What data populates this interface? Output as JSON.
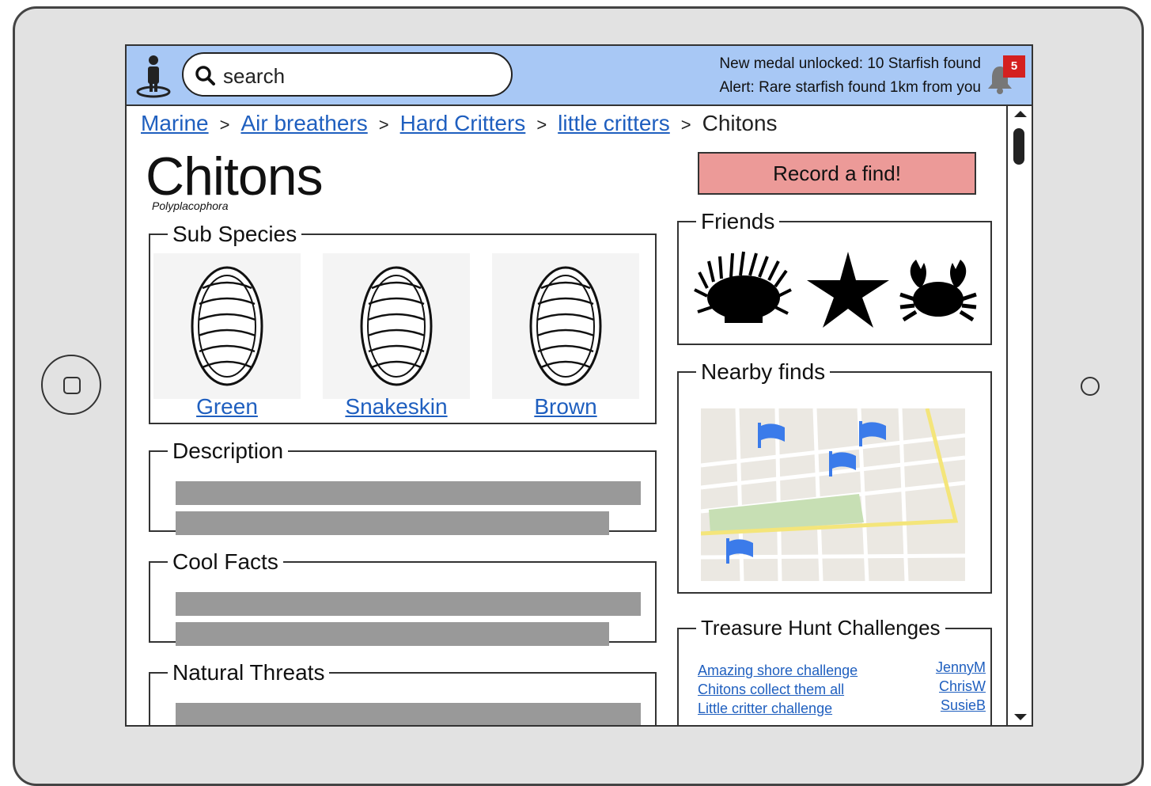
{
  "header": {
    "search_placeholder": "search",
    "alerts": [
      "New medal unlocked: 10 Starfish found",
      "Alert: Rare starfish found 1km from you"
    ],
    "notification_count": "5"
  },
  "breadcrumb": {
    "links": [
      "Marine",
      "Air breathers",
      "Hard Critters",
      "little critters"
    ],
    "current": "Chitons",
    "separator": ">"
  },
  "page": {
    "title": "Chitons",
    "scientific_name": "Polyplacophora",
    "record_button": "Record a find!"
  },
  "sub_species": {
    "legend": "Sub Species",
    "items": [
      "Green",
      "Snakeskin",
      "Brown"
    ]
  },
  "sections": {
    "description": "Description",
    "cool_facts": "Cool Facts",
    "natural_threats": "Natural Threats"
  },
  "friends": {
    "legend": "Friends",
    "icons": [
      "sea-anemone-icon",
      "starfish-icon",
      "crab-icon"
    ]
  },
  "nearby": {
    "legend": "Nearby finds",
    "markers": [
      "flag-icon",
      "flag-icon",
      "flag-icon",
      "flag-icon"
    ]
  },
  "challenges": {
    "legend": "Treasure Hunt Challenges",
    "items": [
      "Amazing shore challenge",
      "Chitons collect them all",
      "Little critter challenge"
    ],
    "users": [
      "JennyM",
      "ChrisW",
      "SusieB"
    ]
  },
  "colors": {
    "header_bg": "#a8c8f5",
    "record_button_bg": "#ec9a98",
    "link": "#1f5fbf",
    "badge": "#d42020",
    "flag": "#3b7bea"
  }
}
